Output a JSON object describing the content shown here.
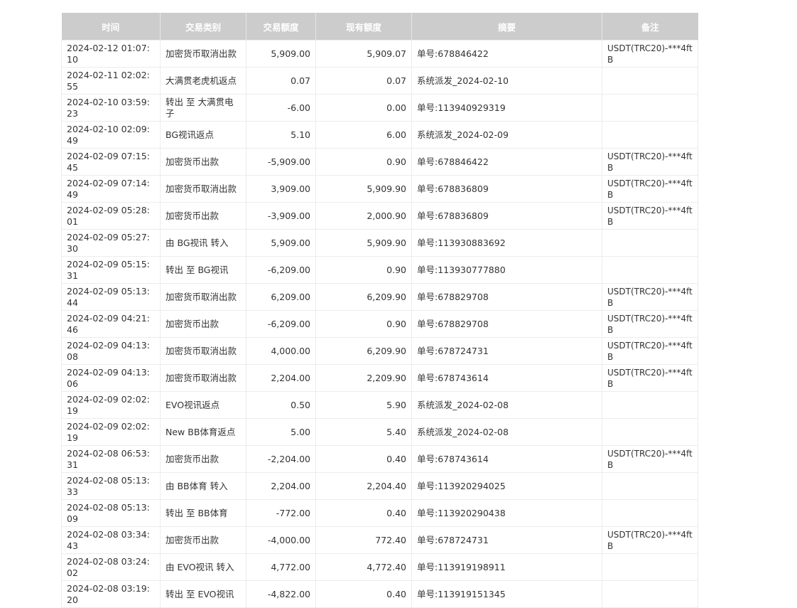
{
  "table": {
    "headers": [
      "时间",
      "交易类别",
      "交易额度",
      "现有额度",
      "摘要",
      "备注"
    ],
    "rows": [
      {
        "time": "2024-02-12 01:07:10",
        "type": "加密货币取消出款",
        "amount": "5,909.00",
        "balance": "5,909.07",
        "summary": "单号:678846422",
        "note": "USDT(TRC20)-***4ftB"
      },
      {
        "time": "2024-02-11 02:02:55",
        "type": "大满贯老虎机返点",
        "amount": "0.07",
        "balance": "0.07",
        "summary": "系统派发_2024-02-10",
        "note": ""
      },
      {
        "time": "2024-02-10 03:59:23",
        "type": "转出 至 大满贯电子",
        "amount": "-6.00",
        "balance": "0.00",
        "summary": "单号:113940929319",
        "note": ""
      },
      {
        "time": "2024-02-10 02:09:49",
        "type": "BG视讯返点",
        "amount": "5.10",
        "balance": "6.00",
        "summary": "系统派发_2024-02-09",
        "note": ""
      },
      {
        "time": "2024-02-09 07:15:45",
        "type": "加密货币出款",
        "amount": "-5,909.00",
        "balance": "0.90",
        "summary": "单号:678846422",
        "note": "USDT(TRC20)-***4ftB"
      },
      {
        "time": "2024-02-09 07:14:49",
        "type": "加密货币取消出款",
        "amount": "3,909.00",
        "balance": "5,909.90",
        "summary": "单号:678836809",
        "note": "USDT(TRC20)-***4ftB"
      },
      {
        "time": "2024-02-09 05:28:01",
        "type": "加密货币出款",
        "amount": "-3,909.00",
        "balance": "2,000.90",
        "summary": "单号:678836809",
        "note": "USDT(TRC20)-***4ftB"
      },
      {
        "time": "2024-02-09 05:27:30",
        "type": "由 BG视讯 转入",
        "amount": "5,909.00",
        "balance": "5,909.90",
        "summary": "单号:113930883692",
        "note": ""
      },
      {
        "time": "2024-02-09 05:15:31",
        "type": "转出 至 BG视讯",
        "amount": "-6,209.00",
        "balance": "0.90",
        "summary": "单号:113930777880",
        "note": ""
      },
      {
        "time": "2024-02-09 05:13:44",
        "type": "加密货币取消出款",
        "amount": "6,209.00",
        "balance": "6,209.90",
        "summary": "单号:678829708",
        "note": "USDT(TRC20)-***4ftB"
      },
      {
        "time": "2024-02-09 04:21:46",
        "type": "加密货币出款",
        "amount": "-6,209.00",
        "balance": "0.90",
        "summary": "单号:678829708",
        "note": "USDT(TRC20)-***4ftB"
      },
      {
        "time": "2024-02-09 04:13:08",
        "type": "加密货币取消出款",
        "amount": "4,000.00",
        "balance": "6,209.90",
        "summary": "单号:678724731",
        "note": "USDT(TRC20)-***4ftB"
      },
      {
        "time": "2024-02-09 04:13:06",
        "type": "加密货币取消出款",
        "amount": "2,204.00",
        "balance": "2,209.90",
        "summary": "单号:678743614",
        "note": "USDT(TRC20)-***4ftB"
      },
      {
        "time": "2024-02-09 02:02:19",
        "type": "EVO视讯返点",
        "amount": "0.50",
        "balance": "5.90",
        "summary": "系统派发_2024-02-08",
        "note": ""
      },
      {
        "time": "2024-02-09 02:02:19",
        "type": "New BB体育返点",
        "amount": "5.00",
        "balance": "5.40",
        "summary": "系统派发_2024-02-08",
        "note": ""
      },
      {
        "time": "2024-02-08 06:53:31",
        "type": "加密货币出款",
        "amount": "-2,204.00",
        "balance": "0.40",
        "summary": "单号:678743614",
        "note": "USDT(TRC20)-***4ftB"
      },
      {
        "time": "2024-02-08 05:13:33",
        "type": "由 BB体育 转入",
        "amount": "2,204.00",
        "balance": "2,204.40",
        "summary": "单号:113920294025",
        "note": ""
      },
      {
        "time": "2024-02-08 05:13:09",
        "type": "转出 至 BB体育",
        "amount": "-772.00",
        "balance": "0.40",
        "summary": "单号:113920290438",
        "note": ""
      },
      {
        "time": "2024-02-08 03:34:43",
        "type": "加密货币出款",
        "amount": "-4,000.00",
        "balance": "772.40",
        "summary": "单号:678724731",
        "note": "USDT(TRC20)-***4ftB"
      },
      {
        "time": "2024-02-08 03:24:02",
        "type": "由 EVO视讯 转入",
        "amount": "4,772.00",
        "balance": "4,772.40",
        "summary": "单号:113919198911",
        "note": ""
      },
      {
        "time": "2024-02-08 03:19:20",
        "type": "转出 至 EVO视讯",
        "amount": "-4,822.00",
        "balance": "0.40",
        "summary": "单号:113919151345",
        "note": ""
      }
    ]
  }
}
